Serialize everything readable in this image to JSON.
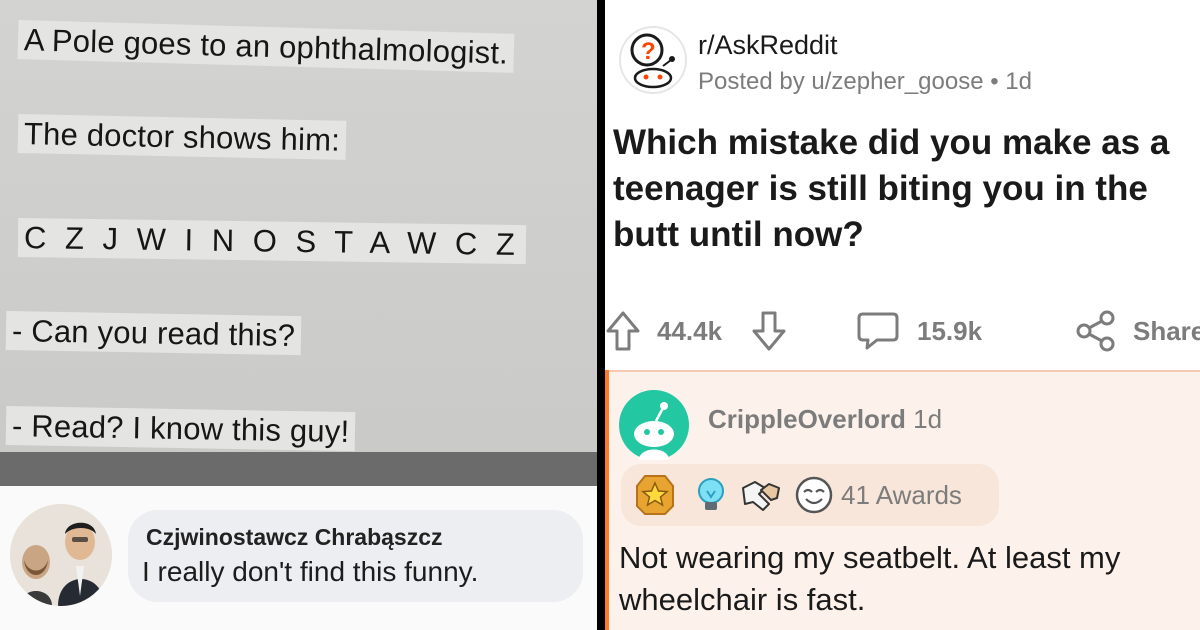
{
  "joke": {
    "line1": "A Pole goes to an ophthalmologist.",
    "line2": "The doctor shows him:",
    "line3": "C Z J W I N O S T A W C Z",
    "line4": "- Can you read this?",
    "line5": "- Read? I know this guy!"
  },
  "facebook_comment": {
    "name": "Czjwinostawcz Chrabąszcz",
    "text": "I really don't find this funny."
  },
  "reddit": {
    "subreddit": "r/AskReddit",
    "posted_by": "Posted by u/zepher_goose",
    "post_age": "1d",
    "title": "Which mistake did you make as a teenager is still biting you in the butt until now?",
    "upvotes": "44.4k",
    "comments": "15.9k",
    "share_label": "Share",
    "comment": {
      "author": "CrippleOverlord",
      "age": "1d",
      "awards_label": "41 Awards",
      "text": "Not wearing my seatbelt. At least my wheelchair is fast."
    },
    "colors": {
      "accent": "#ff4500",
      "avatar_teal": "#23c8a3",
      "comment_bg": "#fdf2eb"
    },
    "icons": [
      "upvote-icon",
      "downvote-icon",
      "comment-icon",
      "share-icon",
      "award-icon"
    ]
  }
}
